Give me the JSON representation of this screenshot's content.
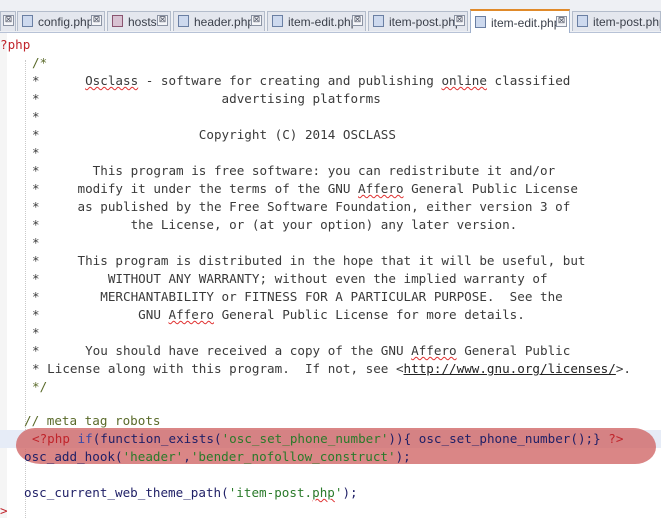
{
  "tabs": [
    {
      "label": "",
      "icon": "close-icon",
      "active": false
    },
    {
      "label": "config.php",
      "icon": "php-file-icon",
      "active": false
    },
    {
      "label": "hosts",
      "icon": "hosts-file-icon",
      "active": false
    },
    {
      "label": "header.php",
      "icon": "php-file-icon",
      "active": false
    },
    {
      "label": "item-edit.php",
      "icon": "php-file-icon",
      "active": false
    },
    {
      "label": "item-post.php",
      "icon": "php-file-icon",
      "active": false
    },
    {
      "label": "item-edit.php",
      "icon": "php-file-icon",
      "active": true
    },
    {
      "label": "item-post.php",
      "icon": "php-file-icon",
      "active": false
    }
  ],
  "tab_close_glyph": "⊠",
  "code": {
    "php_open": "?php",
    "c_open": "/*",
    "c01a": "*      ",
    "c01w": "Osclass",
    "c01b": " - software for creating and publishing ",
    "c01w2": "online",
    "c01c": " classified",
    "c02": "*                        advertising platforms",
    "c03": "*",
    "c04": "*                     Copyright (C) 2014 OSCLASS",
    "c05": "*",
    "c06": "*       This program is free software: you can redistribute it and/or",
    "c07a": "*     modify it under the terms of the GNU ",
    "c07w": "Affero",
    "c07b": " General Public License",
    "c08": "*     as published by the Free Software Foundation, either version 3 of",
    "c09": "*            the License, or (at your option) any later version.",
    "c10": "*",
    "c11": "*     This program is distributed in the hope that it will be useful, but",
    "c12": "*         WITHOUT ANY WARRANTY; without even the implied warranty of",
    "c13": "*        MERCHANTABILITY or FITNESS FOR A PARTICULAR PURPOSE.  See the",
    "c14a": "*             GNU ",
    "c14w": "Affero",
    "c14b": " General Public License for more details.",
    "c15": "*",
    "c16a": "*      You should have received a copy of the GNU ",
    "c16w": "Affero",
    "c16b": " General Public",
    "c17a": "* License along with this program.  If not, see <",
    "c17u": "http://www.gnu.org/licenses/",
    "c17b": ">.",
    "c_close": "*/",
    "meta_comment": "// meta tag robots",
    "hl_open": "<?php",
    "hl_if": "if",
    "hl_fe": "(function_exists(",
    "hl_str": "'osc_set_phone_number'",
    "hl_mid": ")){ osc_set_phone_number();} ",
    "hl_close": "?>",
    "hook_fn": "osc_add_hook(",
    "hook_s1": "'header'",
    "hook_comma": ",",
    "hook_s2": "'bender_nofollow_construct'",
    "hook_end": ");",
    "theme_fn": "osc_current_web_theme_path(",
    "theme_s": "'item-post.",
    "theme_w": "php",
    "theme_s2": "'",
    "theme_end": ");",
    "last": ">"
  }
}
